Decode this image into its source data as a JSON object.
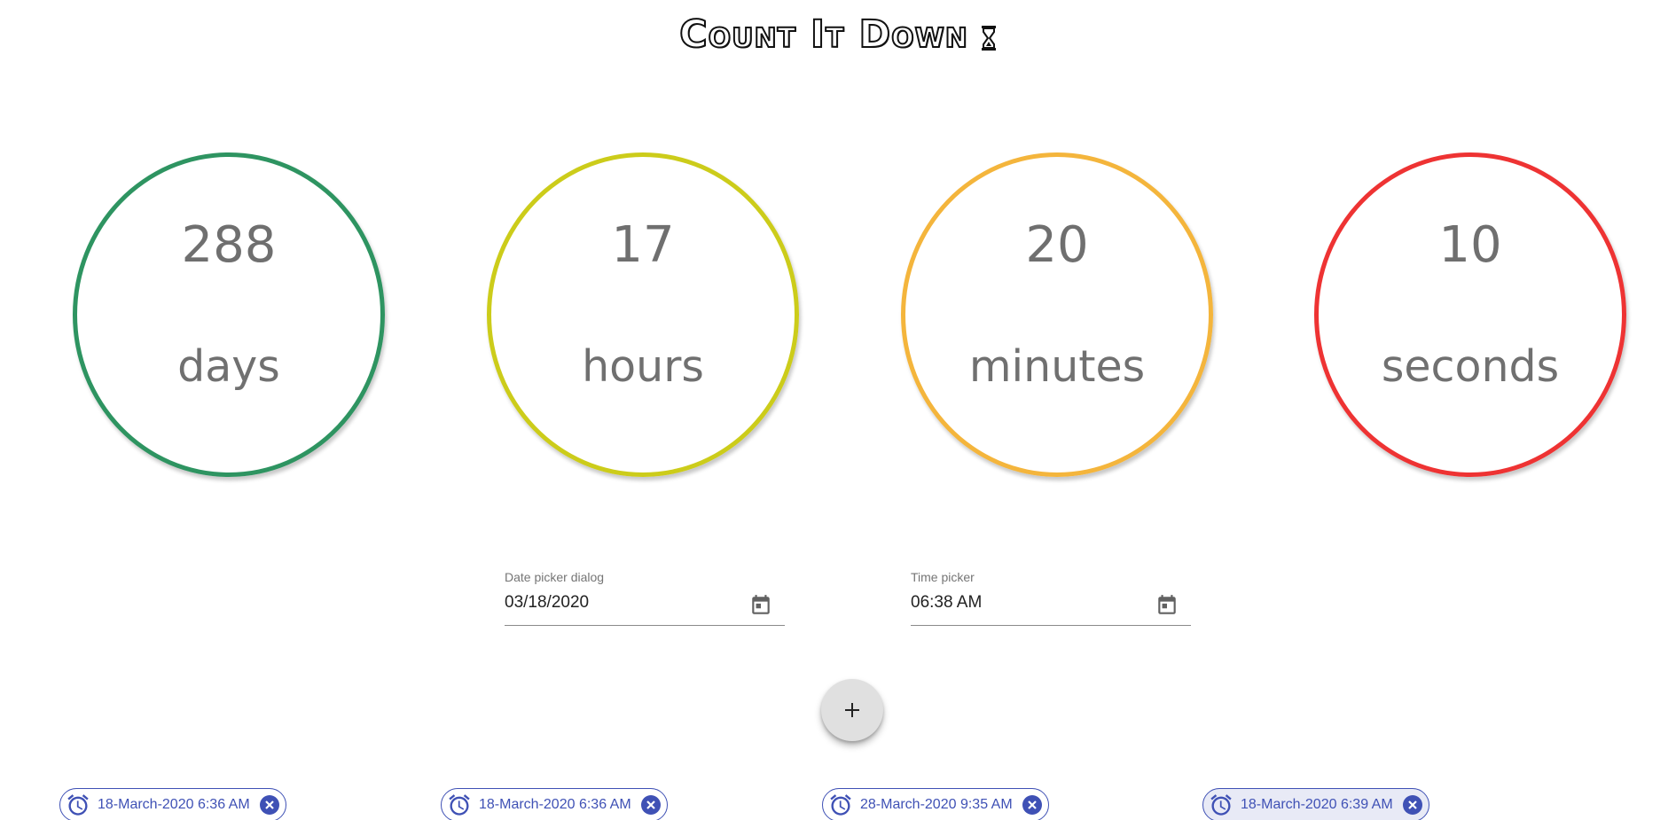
{
  "app": {
    "title": "Count It Down",
    "title_icon": "hourglass-icon"
  },
  "countdown": [
    {
      "value": "288",
      "unit": "days",
      "color": "#2e9461"
    },
    {
      "value": "17",
      "unit": "hours",
      "color": "#cccc1a"
    },
    {
      "value": "20",
      "unit": "minutes",
      "color": "#f4b53c"
    },
    {
      "value": "10",
      "unit": "seconds",
      "color": "#ee3333"
    }
  ],
  "date_picker": {
    "label": "Date picker dialog",
    "value": "03/18/2020",
    "icon": "calendar-icon"
  },
  "time_picker": {
    "label": "Time picker",
    "value": "06:38 AM",
    "icon": "calendar-icon"
  },
  "add_button": {
    "icon": "plus-icon"
  },
  "chips": [
    {
      "label": "18-March-2020 6:36 AM",
      "selected": false
    },
    {
      "label": "18-March-2020 6:36 AM",
      "selected": false
    },
    {
      "label": "28-March-2020 9:35 AM",
      "selected": false
    },
    {
      "label": "18-March-2020 6:39 AM",
      "selected": true
    }
  ],
  "colors": {
    "chip_accent": "#3f51b5",
    "chip_selected_bg": "#e8eaf6"
  }
}
